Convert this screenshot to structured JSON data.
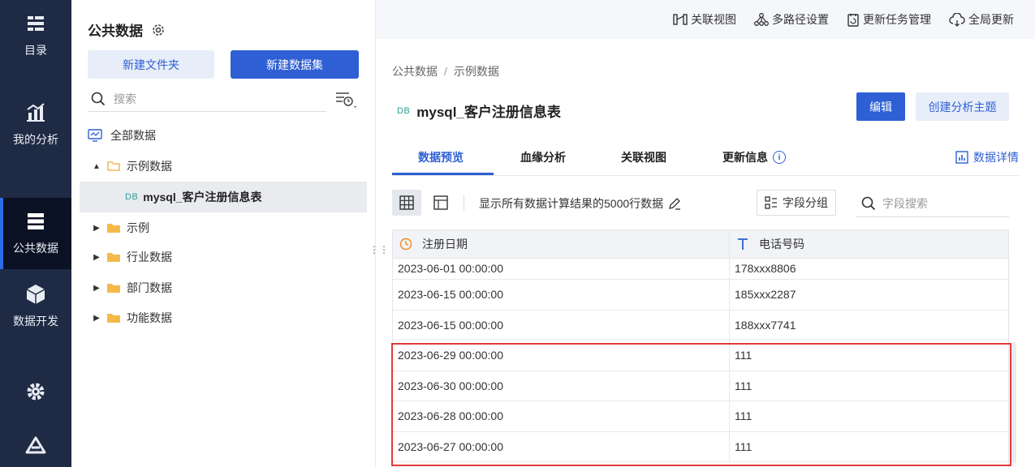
{
  "nav": {
    "items": [
      {
        "label": "目录",
        "icon": "catalog-icon"
      },
      {
        "label": "我的分析",
        "icon": "analysis-icon"
      },
      {
        "label": "公共数据",
        "icon": "public-data-icon"
      },
      {
        "label": "数据开发",
        "icon": "data-dev-icon"
      },
      {
        "label": "",
        "icon": "gear-icon"
      }
    ]
  },
  "tree": {
    "title": "公共数据",
    "new_folder": "新建文件夹",
    "new_dataset": "新建数据集",
    "search_placeholder": "搜索",
    "items": [
      {
        "label": "全部数据"
      },
      {
        "label": "示例数据"
      },
      {
        "label": "mysql_客户注册信息表",
        "badge": "DB"
      },
      {
        "label": "示例"
      },
      {
        "label": "行业数据"
      },
      {
        "label": "部门数据"
      },
      {
        "label": "功能数据"
      }
    ]
  },
  "topbar": {
    "related_view": "关联视图",
    "multipath": "多路径设置",
    "update_tasks": "更新任务管理",
    "global_update": "全局更新"
  },
  "breadcrumb": {
    "root": "公共数据",
    "sep": "/",
    "current": "示例数据"
  },
  "dataset": {
    "badge": "DB",
    "title": "mysql_客户注册信息表",
    "edit": "编辑",
    "create_topic": "创建分析主题"
  },
  "tabs": {
    "preview": "数据预览",
    "lineage": "血缘分析",
    "related": "关联视图",
    "update_info": "更新信息",
    "detail": "数据详情"
  },
  "toolbar": {
    "show_text": "显示所有数据计算结果的5000行数据",
    "field_group": "字段分组",
    "field_search": "字段搜索"
  },
  "table": {
    "columns": [
      "注册日期",
      "电话号码"
    ],
    "rows": [
      [
        "2023-06-01 00:00:00",
        "178xxx8806"
      ],
      [
        "2023-06-15 00:00:00",
        "185xxx2287"
      ],
      [
        "2023-06-15 00:00:00",
        "188xxx7741"
      ],
      [
        "2023-06-29 00:00:00",
        "111"
      ],
      [
        "2023-06-30 00:00:00",
        "111"
      ],
      [
        "2023-06-28 00:00:00",
        "111"
      ],
      [
        "2023-06-27 00:00:00",
        "111"
      ]
    ]
  },
  "colors": {
    "primary": "#2e5fd4",
    "nav_bg": "#1f2a44",
    "highlight": "#e23b3b"
  }
}
